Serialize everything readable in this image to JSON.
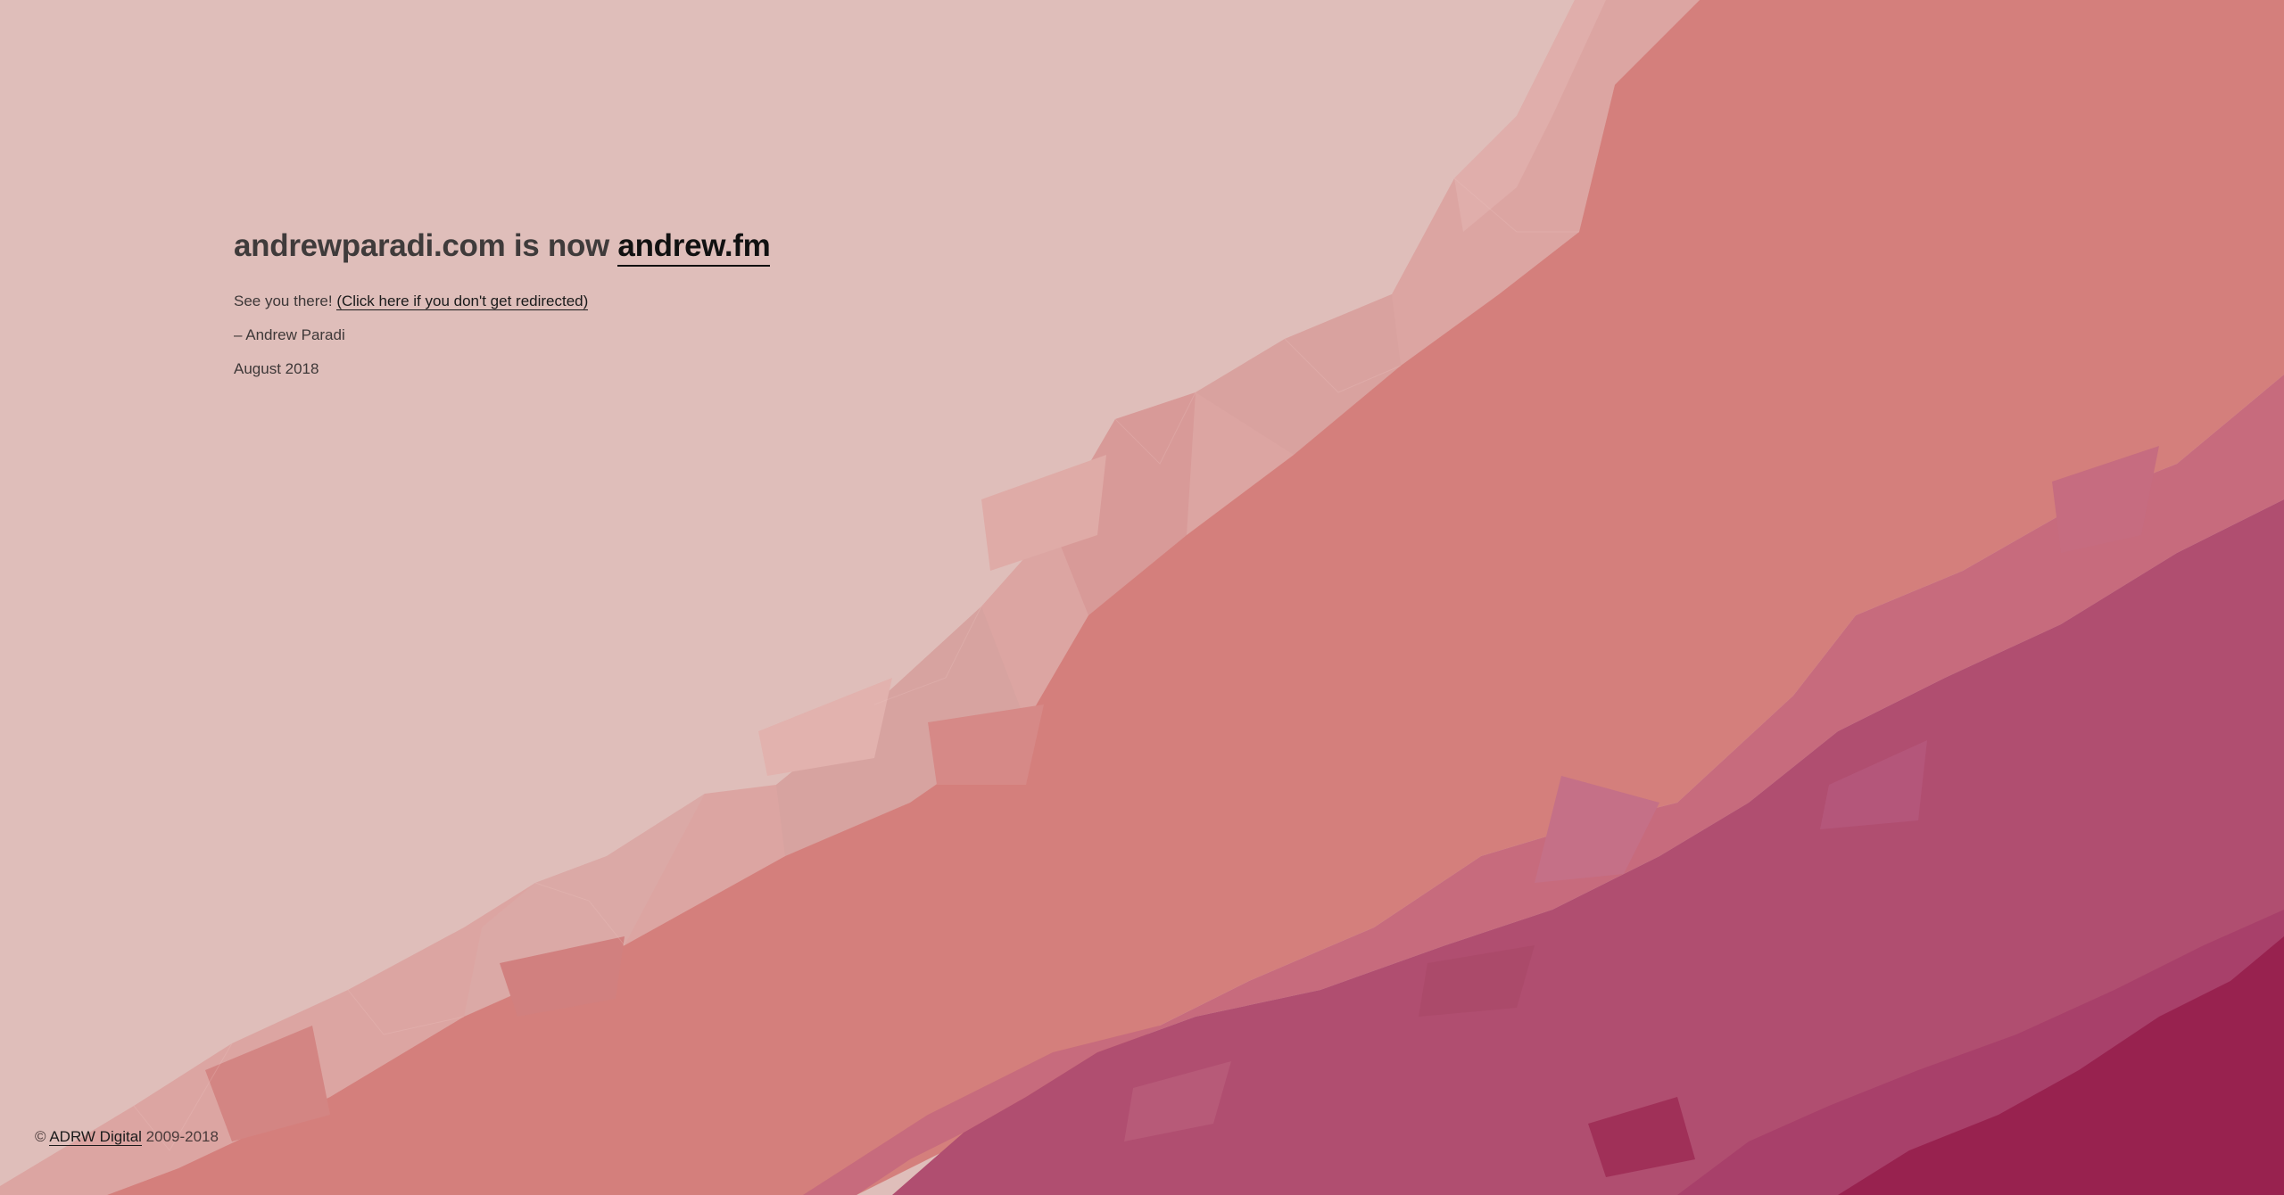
{
  "headline": {
    "prefix": "andrewparadi.com is now",
    "link_text": "andrew.fm"
  },
  "message": {
    "text": "See you there!",
    "redirect_link": "(Click here if you don't get redirected)"
  },
  "signature": "– Andrew Paradi",
  "date": "August 2018",
  "footer": {
    "copyright_symbol": "©",
    "company_link": "ADRW Digital",
    "years": "2009-2018"
  },
  "colors": {
    "background_light": "#dfbeba",
    "band_coral": "#d47f7c",
    "band_plum": "#b04e70",
    "band_deep": "#98224f",
    "facet_light": "#dca2a0"
  }
}
